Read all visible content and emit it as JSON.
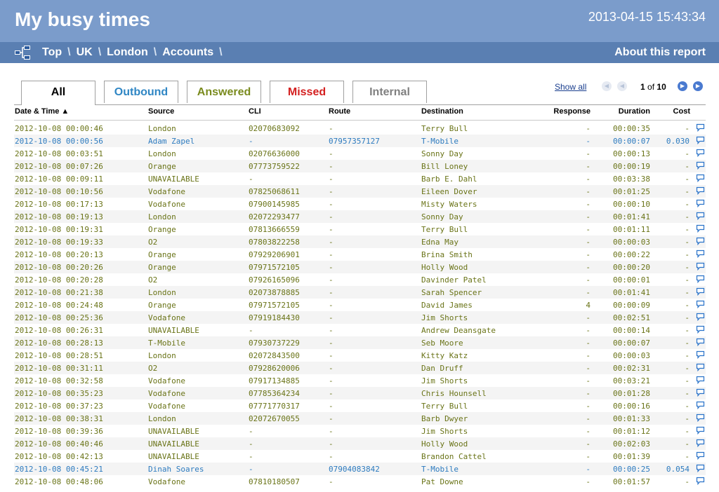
{
  "header": {
    "title": "My busy times",
    "datetime": "2013-04-15 15:43:34"
  },
  "breadcrumb": {
    "items": [
      "Top",
      "UK",
      "London",
      "Accounts"
    ],
    "separator": "\\",
    "about": "About this report"
  },
  "tabs": {
    "all": "All",
    "outbound": "Outbound",
    "answered": "Answered",
    "missed": "Missed",
    "internal": "Internal"
  },
  "paging": {
    "show_all": "Show all",
    "current": "1",
    "of_text": "of",
    "total": "10"
  },
  "columns": [
    "Date & Time ▲",
    "Source",
    "CLI",
    "Route",
    "Destination",
    "Response",
    "Duration",
    "Cost"
  ],
  "colors": {
    "header_bg": "#7b9ccb",
    "crumb_bg": "#5a7fb2",
    "inbound_text": "#6a7418",
    "outbound_text": "#2d7bbf"
  },
  "rows": [
    {
      "dt": "2012-10-08 00:00:46",
      "src": "London",
      "cli": "02070683092",
      "route": "-",
      "dest": "Terry Bull",
      "resp": "-",
      "dur": "00:00:35",
      "cost": "-",
      "out": false
    },
    {
      "dt": "2012-10-08 00:00:56",
      "src": "Adam Zapel",
      "cli": "-",
      "route": "07957357127",
      "dest": "T-Mobile",
      "resp": "-",
      "dur": "00:00:07",
      "cost": "0.030",
      "out": true
    },
    {
      "dt": "2012-10-08 00:03:51",
      "src": "London",
      "cli": "02076636000",
      "route": "-",
      "dest": "Sonny Day",
      "resp": "-",
      "dur": "00:00:13",
      "cost": "-",
      "out": false
    },
    {
      "dt": "2012-10-08 00:07:26",
      "src": "Orange",
      "cli": "07773759522",
      "route": "-",
      "dest": "Bill Loney",
      "resp": "-",
      "dur": "00:00:19",
      "cost": "-",
      "out": false
    },
    {
      "dt": "2012-10-08 00:09:11",
      "src": "UNAVAILABLE",
      "cli": "-",
      "route": "-",
      "dest": "Barb E. Dahl",
      "resp": "-",
      "dur": "00:03:38",
      "cost": "-",
      "out": false
    },
    {
      "dt": "2012-10-08 00:10:56",
      "src": "Vodafone",
      "cli": "07825068611",
      "route": "-",
      "dest": "Eileen Dover",
      "resp": "-",
      "dur": "00:01:25",
      "cost": "-",
      "out": false
    },
    {
      "dt": "2012-10-08 00:17:13",
      "src": "Vodafone",
      "cli": "07900145985",
      "route": "-",
      "dest": "Misty Waters",
      "resp": "-",
      "dur": "00:00:10",
      "cost": "-",
      "out": false
    },
    {
      "dt": "2012-10-08 00:19:13",
      "src": "London",
      "cli": "02072293477",
      "route": "-",
      "dest": "Sonny Day",
      "resp": "-",
      "dur": "00:01:41",
      "cost": "-",
      "out": false
    },
    {
      "dt": "2012-10-08 00:19:31",
      "src": "Orange",
      "cli": "07813666559",
      "route": "-",
      "dest": "Terry Bull",
      "resp": "-",
      "dur": "00:01:11",
      "cost": "-",
      "out": false
    },
    {
      "dt": "2012-10-08 00:19:33",
      "src": "O2",
      "cli": "07803822258",
      "route": "-",
      "dest": "Edna May",
      "resp": "-",
      "dur": "00:00:03",
      "cost": "-",
      "out": false
    },
    {
      "dt": "2012-10-08 00:20:13",
      "src": "Orange",
      "cli": "07929206901",
      "route": "-",
      "dest": "Brina Smith",
      "resp": "-",
      "dur": "00:00:22",
      "cost": "-",
      "out": false
    },
    {
      "dt": "2012-10-08 00:20:26",
      "src": "Orange",
      "cli": "07971572105",
      "route": "-",
      "dest": "Holly Wood",
      "resp": "-",
      "dur": "00:00:20",
      "cost": "-",
      "out": false
    },
    {
      "dt": "2012-10-08 00:20:28",
      "src": "O2",
      "cli": "07926165096",
      "route": "-",
      "dest": "Davinder Patel",
      "resp": "-",
      "dur": "00:00:01",
      "cost": "-",
      "out": false
    },
    {
      "dt": "2012-10-08 00:21:38",
      "src": "London",
      "cli": "02073878885",
      "route": "-",
      "dest": "Sarah Spencer",
      "resp": "-",
      "dur": "00:01:41",
      "cost": "-",
      "out": false
    },
    {
      "dt": "2012-10-08 00:24:48",
      "src": "Orange",
      "cli": "07971572105",
      "route": "-",
      "dest": "David James",
      "resp": "4",
      "dur": "00:00:09",
      "cost": "-",
      "out": false
    },
    {
      "dt": "2012-10-08 00:25:36",
      "src": "Vodafone",
      "cli": "07919184430",
      "route": "-",
      "dest": "Jim Shorts",
      "resp": "-",
      "dur": "00:02:51",
      "cost": "-",
      "out": false
    },
    {
      "dt": "2012-10-08 00:26:31",
      "src": "UNAVAILABLE",
      "cli": "-",
      "route": "-",
      "dest": "Andrew Deansgate",
      "resp": "-",
      "dur": "00:00:14",
      "cost": "-",
      "out": false
    },
    {
      "dt": "2012-10-08 00:28:13",
      "src": "T-Mobile",
      "cli": "07930737229",
      "route": "-",
      "dest": "Seb Moore",
      "resp": "-",
      "dur": "00:00:07",
      "cost": "-",
      "out": false
    },
    {
      "dt": "2012-10-08 00:28:51",
      "src": "London",
      "cli": "02072843500",
      "route": "-",
      "dest": "Kitty Katz",
      "resp": "-",
      "dur": "00:00:03",
      "cost": "-",
      "out": false
    },
    {
      "dt": "2012-10-08 00:31:11",
      "src": "O2",
      "cli": "07928620006",
      "route": "-",
      "dest": "Dan Druff",
      "resp": "-",
      "dur": "00:02:31",
      "cost": "-",
      "out": false
    },
    {
      "dt": "2012-10-08 00:32:58",
      "src": "Vodafone",
      "cli": "07917134885",
      "route": "-",
      "dest": "Jim Shorts",
      "resp": "-",
      "dur": "00:03:21",
      "cost": "-",
      "out": false
    },
    {
      "dt": "2012-10-08 00:35:23",
      "src": "Vodafone",
      "cli": "07785364234",
      "route": "-",
      "dest": "Chris Hounsell",
      "resp": "-",
      "dur": "00:01:28",
      "cost": "-",
      "out": false
    },
    {
      "dt": "2012-10-08 00:37:23",
      "src": "Vodafone",
      "cli": "07771770317",
      "route": "-",
      "dest": "Terry Bull",
      "resp": "-",
      "dur": "00:00:16",
      "cost": "-",
      "out": false
    },
    {
      "dt": "2012-10-08 00:38:31",
      "src": "London",
      "cli": "02072670055",
      "route": "-",
      "dest": "Barb Dwyer",
      "resp": "-",
      "dur": "00:01:33",
      "cost": "-",
      "out": false
    },
    {
      "dt": "2012-10-08 00:39:36",
      "src": "UNAVAILABLE",
      "cli": "-",
      "route": "-",
      "dest": "Jim Shorts",
      "resp": "-",
      "dur": "00:01:12",
      "cost": "-",
      "out": false
    },
    {
      "dt": "2012-10-08 00:40:46",
      "src": "UNAVAILABLE",
      "cli": "-",
      "route": "-",
      "dest": "Holly Wood",
      "resp": "-",
      "dur": "00:02:03",
      "cost": "-",
      "out": false
    },
    {
      "dt": "2012-10-08 00:42:13",
      "src": "UNAVAILABLE",
      "cli": "-",
      "route": "-",
      "dest": "Brandon Cattel",
      "resp": "-",
      "dur": "00:01:39",
      "cost": "-",
      "out": false
    },
    {
      "dt": "2012-10-08 00:45:21",
      "src": "Dinah Soares",
      "cli": "-",
      "route": "07904083842",
      "dest": "T-Mobile",
      "resp": "-",
      "dur": "00:00:25",
      "cost": "0.054",
      "out": true
    },
    {
      "dt": "2012-10-08 00:48:06",
      "src": "Vodafone",
      "cli": "07810180507",
      "route": "-",
      "dest": "Pat Downe",
      "resp": "-",
      "dur": "00:01:57",
      "cost": "-",
      "out": false
    }
  ]
}
